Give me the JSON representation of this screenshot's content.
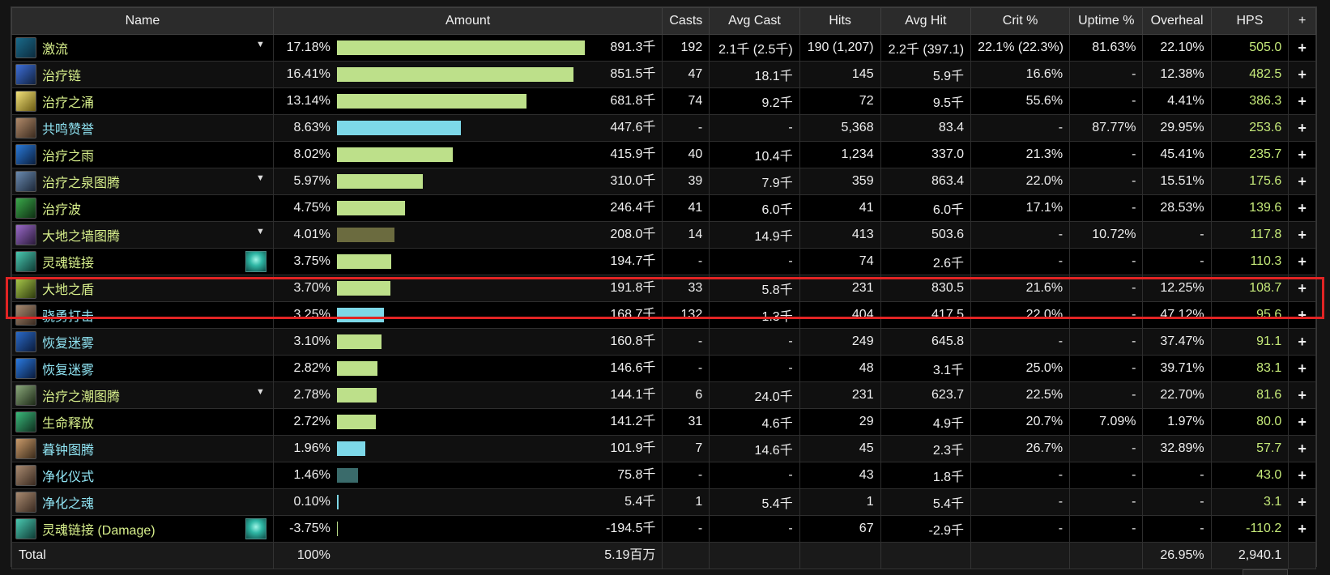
{
  "header": {
    "name": "Name",
    "amount": "Amount",
    "casts": "Casts",
    "avg_cast": "Avg Cast",
    "hits": "Hits",
    "avg_hit": "Avg Hit",
    "crit": "Crit %",
    "uptime": "Uptime %",
    "overheal": "Overheal",
    "hps": "HPS",
    "plus": "+"
  },
  "colors": {
    "nature_green_text": "#d8f08c",
    "physical_cyan_text": "#8fe3f2",
    "bar_green": "#bde08a",
    "bar_cyan": "#7dd8e8",
    "bar_olive": "#6b6b3f",
    "bar_teal": "#3a6b6b",
    "hps_green": "#c6ea7a",
    "highlight_red": "#e12424"
  },
  "rows": [
    {
      "icon": "riptide-icon",
      "icon_colors": [
        "#1a6a8a",
        "#0c2b3d"
      ],
      "name": "激流",
      "school": "green",
      "dropdown": true,
      "badge": false,
      "pct": "17.18%",
      "fill": 1.0,
      "bar": "green",
      "amount": "891.3千",
      "casts": "192",
      "avg_cast": "2.1千 (2.5千)",
      "hits": "190 (1,207)",
      "avg_hit": "2.2千 (397.1)",
      "crit": "22.1% (22.3%)",
      "uptime": "81.63%",
      "overheal": "22.10%",
      "hps": "505.0",
      "plus": "+"
    },
    {
      "icon": "chain-heal-icon",
      "icon_colors": [
        "#3e6fd8",
        "#10213f"
      ],
      "name": "治疗链",
      "school": "green",
      "dropdown": false,
      "badge": false,
      "pct": "16.41%",
      "fill": 0.955,
      "bar": "green",
      "amount": "851.5千",
      "casts": "47",
      "avg_cast": "18.1千",
      "hits": "145",
      "avg_hit": "5.9千",
      "crit": "16.6%",
      "uptime": "-",
      "overheal": "12.38%",
      "hps": "482.5",
      "plus": "+"
    },
    {
      "icon": "healing-surge-icon",
      "icon_colors": [
        "#f2e17a",
        "#6a5a12"
      ],
      "name": "治疗之涌",
      "school": "green",
      "dropdown": false,
      "badge": false,
      "pct": "13.14%",
      "fill": 0.765,
      "bar": "green",
      "amount": "681.8千",
      "casts": "74",
      "avg_cast": "9.2千",
      "hits": "72",
      "avg_hit": "9.5千",
      "crit": "55.6%",
      "uptime": "-",
      "overheal": "4.41%",
      "hps": "386.3",
      "plus": "+"
    },
    {
      "icon": "resonant-accolade-icon",
      "icon_colors": [
        "#b08a6a",
        "#3a2a1e"
      ],
      "name": "共鸣赞誉",
      "school": "cyan",
      "dropdown": false,
      "badge": false,
      "pct": "8.63%",
      "fill": 0.502,
      "bar": "cyan",
      "amount": "447.6千",
      "casts": "-",
      "avg_cast": "-",
      "hits": "5,368",
      "avg_hit": "83.4",
      "crit": "-",
      "uptime": "87.77%",
      "overheal": "29.95%",
      "hps": "253.6",
      "plus": "+"
    },
    {
      "icon": "healing-rain-icon",
      "icon_colors": [
        "#2a7ad8",
        "#0a1e3e"
      ],
      "name": "治疗之雨",
      "school": "green",
      "dropdown": false,
      "badge": false,
      "pct": "8.02%",
      "fill": 0.467,
      "bar": "green",
      "amount": "415.9千",
      "casts": "40",
      "avg_cast": "10.4千",
      "hits": "1,234",
      "avg_hit": "337.0",
      "crit": "21.3%",
      "uptime": "-",
      "overheal": "45.41%",
      "hps": "235.7",
      "plus": "+"
    },
    {
      "icon": "healing-stream-totem-icon",
      "icon_colors": [
        "#6a8ab0",
        "#1c2838"
      ],
      "name": "治疗之泉图腾",
      "school": "green",
      "dropdown": true,
      "badge": false,
      "pct": "5.97%",
      "fill": 0.348,
      "bar": "green",
      "amount": "310.0千",
      "casts": "39",
      "avg_cast": "7.9千",
      "hits": "359",
      "avg_hit": "863.4",
      "crit": "22.0%",
      "uptime": "-",
      "overheal": "15.51%",
      "hps": "175.6",
      "plus": "+"
    },
    {
      "icon": "healing-wave-icon",
      "icon_colors": [
        "#3aa84a",
        "#0e2e12"
      ],
      "name": "治疗波",
      "school": "green",
      "dropdown": false,
      "badge": false,
      "pct": "4.75%",
      "fill": 0.276,
      "bar": "green",
      "amount": "246.4千",
      "casts": "41",
      "avg_cast": "6.0千",
      "hits": "41",
      "avg_hit": "6.0千",
      "crit": "17.1%",
      "uptime": "-",
      "overheal": "28.53%",
      "hps": "139.6",
      "plus": "+"
    },
    {
      "icon": "earthen-wall-totem-icon",
      "icon_colors": [
        "#9a6ac8",
        "#2a1a3a"
      ],
      "name": "大地之墙图腾",
      "school": "green",
      "dropdown": true,
      "badge": false,
      "pct": "4.01%",
      "fill": 0.233,
      "bar": "olive",
      "amount": "208.0千",
      "casts": "14",
      "avg_cast": "14.9千",
      "hits": "413",
      "avg_hit": "503.6",
      "crit": "-",
      "uptime": "10.72%",
      "overheal": "-",
      "hps": "117.8",
      "plus": "+"
    },
    {
      "icon": "spirit-link-icon",
      "icon_colors": [
        "#4ac8b0",
        "#0e3a34"
      ],
      "name": "灵魂链接",
      "school": "green",
      "dropdown": false,
      "badge": true,
      "pct": "3.75%",
      "fill": 0.218,
      "bar": "green",
      "amount": "194.7千",
      "casts": "-",
      "avg_cast": "-",
      "hits": "74",
      "avg_hit": "2.6千",
      "crit": "-",
      "uptime": "-",
      "overheal": "-",
      "hps": "110.3",
      "plus": "+"
    },
    {
      "icon": "earth-shield-icon",
      "icon_colors": [
        "#a8c84a",
        "#2e3a0e"
      ],
      "name": "大地之盾",
      "school": "green",
      "dropdown": false,
      "badge": false,
      "pct": "3.70%",
      "fill": 0.215,
      "bar": "green",
      "amount": "191.8千",
      "casts": "33",
      "avg_cast": "5.8千",
      "hits": "231",
      "avg_hit": "830.5",
      "crit": "21.6%",
      "uptime": "-",
      "overheal": "12.25%",
      "hps": "108.7",
      "plus": "+"
    },
    {
      "icon": "valorous-strike-icon",
      "icon_colors": [
        "#a88a70",
        "#3a2a20"
      ],
      "name": "骁勇打击",
      "school": "cyan",
      "dropdown": false,
      "badge": false,
      "pct": "3.25%",
      "fill": 0.189,
      "bar": "cyan",
      "amount": "168.7千",
      "casts": "132",
      "avg_cast": "1.3千",
      "hits": "404",
      "avg_hit": "417.5",
      "crit": "22.0%",
      "uptime": "-",
      "overheal": "47.12%",
      "hps": "95.6",
      "plus": "+"
    },
    {
      "icon": "restorative-mists-icon",
      "icon_colors": [
        "#2a6ac8",
        "#0a1a3a"
      ],
      "name": "恢复迷雾",
      "school": "cyan",
      "dropdown": false,
      "badge": false,
      "pct": "3.10%",
      "fill": 0.18,
      "bar": "green",
      "amount": "160.8千",
      "casts": "-",
      "avg_cast": "-",
      "hits": "249",
      "avg_hit": "645.8",
      "crit": "-",
      "uptime": "-",
      "overheal": "37.47%",
      "hps": "91.1",
      "plus": "+"
    },
    {
      "icon": "restorative-mists-icon",
      "icon_colors": [
        "#2a7ae0",
        "#0a1a3a"
      ],
      "name": "恢复迷雾",
      "school": "cyan",
      "dropdown": false,
      "badge": false,
      "pct": "2.82%",
      "fill": 0.164,
      "bar": "green",
      "amount": "146.6千",
      "casts": "-",
      "avg_cast": "-",
      "hits": "48",
      "avg_hit": "3.1千",
      "crit": "25.0%",
      "uptime": "-",
      "overheal": "39.71%",
      "hps": "83.1",
      "plus": "+"
    },
    {
      "icon": "healing-tide-totem-icon",
      "icon_colors": [
        "#8aa87a",
        "#1e2a18"
      ],
      "name": "治疗之潮图腾",
      "school": "green",
      "dropdown": true,
      "badge": false,
      "pct": "2.78%",
      "fill": 0.162,
      "bar": "green",
      "amount": "144.1千",
      "casts": "6",
      "avg_cast": "24.0千",
      "hits": "231",
      "avg_hit": "623.7",
      "crit": "22.5%",
      "uptime": "-",
      "overheal": "22.70%",
      "hps": "81.6",
      "plus": "+"
    },
    {
      "icon": "emerald-communion-icon",
      "icon_colors": [
        "#3ab87a",
        "#0e2e1e"
      ],
      "name": "生命释放",
      "school": "green",
      "dropdown": false,
      "badge": false,
      "pct": "2.72%",
      "fill": 0.158,
      "bar": "green",
      "amount": "141.2千",
      "casts": "31",
      "avg_cast": "4.6千",
      "hits": "29",
      "avg_hit": "4.9千",
      "crit": "20.7%",
      "uptime": "7.09%",
      "overheal": "1.97%",
      "hps": "80.0",
      "plus": "+"
    },
    {
      "icon": "dusk-bell-totem-icon",
      "icon_colors": [
        "#c89a6a",
        "#3a2a1a"
      ],
      "name": "暮钟图腾",
      "school": "cyan",
      "dropdown": false,
      "badge": false,
      "pct": "1.96%",
      "fill": 0.114,
      "bar": "cyan",
      "amount": "101.9千",
      "casts": "7",
      "avg_cast": "14.6千",
      "hits": "45",
      "avg_hit": "2.3千",
      "crit": "26.7%",
      "uptime": "-",
      "overheal": "32.89%",
      "hps": "57.7",
      "plus": "+"
    },
    {
      "icon": "purification-ritual-icon",
      "icon_colors": [
        "#a88a70",
        "#3a2a20"
      ],
      "name": "净化仪式",
      "school": "cyan",
      "dropdown": false,
      "badge": false,
      "pct": "1.46%",
      "fill": 0.085,
      "bar": "teal",
      "amount": "75.8千",
      "casts": "-",
      "avg_cast": "-",
      "hits": "43",
      "avg_hit": "1.8千",
      "crit": "-",
      "uptime": "-",
      "overheal": "-",
      "hps": "43.0",
      "plus": "+"
    },
    {
      "icon": "purified-soul-icon",
      "icon_colors": [
        "#a88a70",
        "#3a2a20"
      ],
      "name": "净化之魂",
      "school": "cyan",
      "dropdown": false,
      "badge": false,
      "pct": "0.10%",
      "fill": 0.006,
      "bar": "cyan",
      "amount": "5.4千",
      "casts": "1",
      "avg_cast": "5.4千",
      "hits": "1",
      "avg_hit": "5.4千",
      "crit": "-",
      "uptime": "-",
      "overheal": "-",
      "hps": "3.1",
      "plus": "+"
    },
    {
      "icon": "spirit-link-icon",
      "icon_colors": [
        "#4ac8b0",
        "#0e3a34"
      ],
      "name": "灵魂链接 (Damage)",
      "school": "green",
      "dropdown": false,
      "badge": true,
      "pct": "-3.75%",
      "fill": 0.004,
      "bar": "green",
      "amount": "-194.5千",
      "casts": "-",
      "avg_cast": "-",
      "hits": "67",
      "avg_hit": "-2.9千",
      "crit": "-",
      "uptime": "-",
      "overheal": "-",
      "hps": "-110.2",
      "plus": "+"
    }
  ],
  "footer": {
    "label": "Total",
    "pct": "100%",
    "amount": "5.19百万",
    "overheal": "26.95%",
    "hps": "2,940.1"
  },
  "highlight": {
    "row_index": 10,
    "color": "#e12424"
  }
}
